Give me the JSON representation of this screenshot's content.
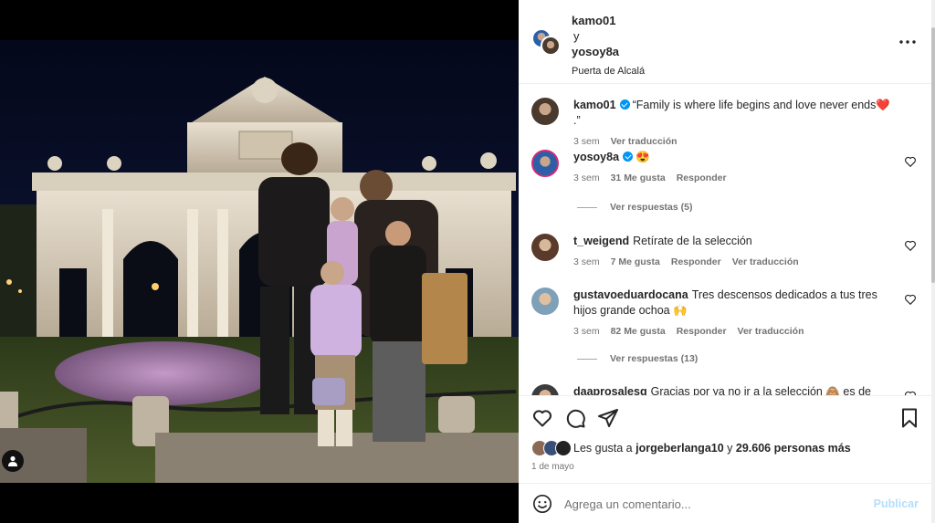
{
  "post": {
    "header": {
      "author1": "kamo01",
      "separator": "y",
      "author2": "yosoy8a",
      "location": "Puerta de Alcalá"
    },
    "comments": [
      {
        "user": "kamo01",
        "verified": true,
        "text": "“Family is where life begins and love never ends",
        "text_suffix": ".”",
        "emoji": "❤️",
        "time": "3 sem",
        "translate": "Ver traducción"
      },
      {
        "user": "yosoy8a",
        "verified": true,
        "text": "",
        "emoji": "😍",
        "time": "3 sem",
        "likes": "31 Me gusta",
        "reply": "Responder",
        "replies": "Ver respuestas (5)"
      },
      {
        "user": "t_weigend",
        "text": "Retírate de la selección",
        "time": "3 sem",
        "likes": "7 Me gusta",
        "reply": "Responder",
        "translate": "Ver traducción"
      },
      {
        "user": "gustavoeduardocana",
        "text": "Tres descensos dedicados a tus tres hijos grande ochoa",
        "emoji": "🙌",
        "time": "3 sem",
        "likes": "82 Me gusta",
        "reply": "Responder",
        "translate": "Ver traducción",
        "replies": "Ver respuestas (13)"
      },
      {
        "user": "daaprosalesg",
        "text": "Gracias por ya no ir a la selección",
        "emoji": "🙈",
        "text_suffix": " es de"
      }
    ],
    "likes": {
      "prefix": "Les gusta a ",
      "user": "jorgeberlanga10",
      "middle": " y ",
      "count": "29.606 personas más"
    },
    "date": "1 de mayo",
    "composer": {
      "placeholder": "Agrega un comentario...",
      "publish": "Publicar"
    }
  },
  "colors": {
    "accent": "#0095f6",
    "publish_disabled": "#b2dffc",
    "secondary_text": "#737373",
    "heart": "#ed4956"
  },
  "icons": [
    "more-icon",
    "heart-icon",
    "comment-icon",
    "share-icon",
    "bookmark-icon",
    "emoji-icon",
    "user-tag-icon",
    "verified-icon"
  ]
}
